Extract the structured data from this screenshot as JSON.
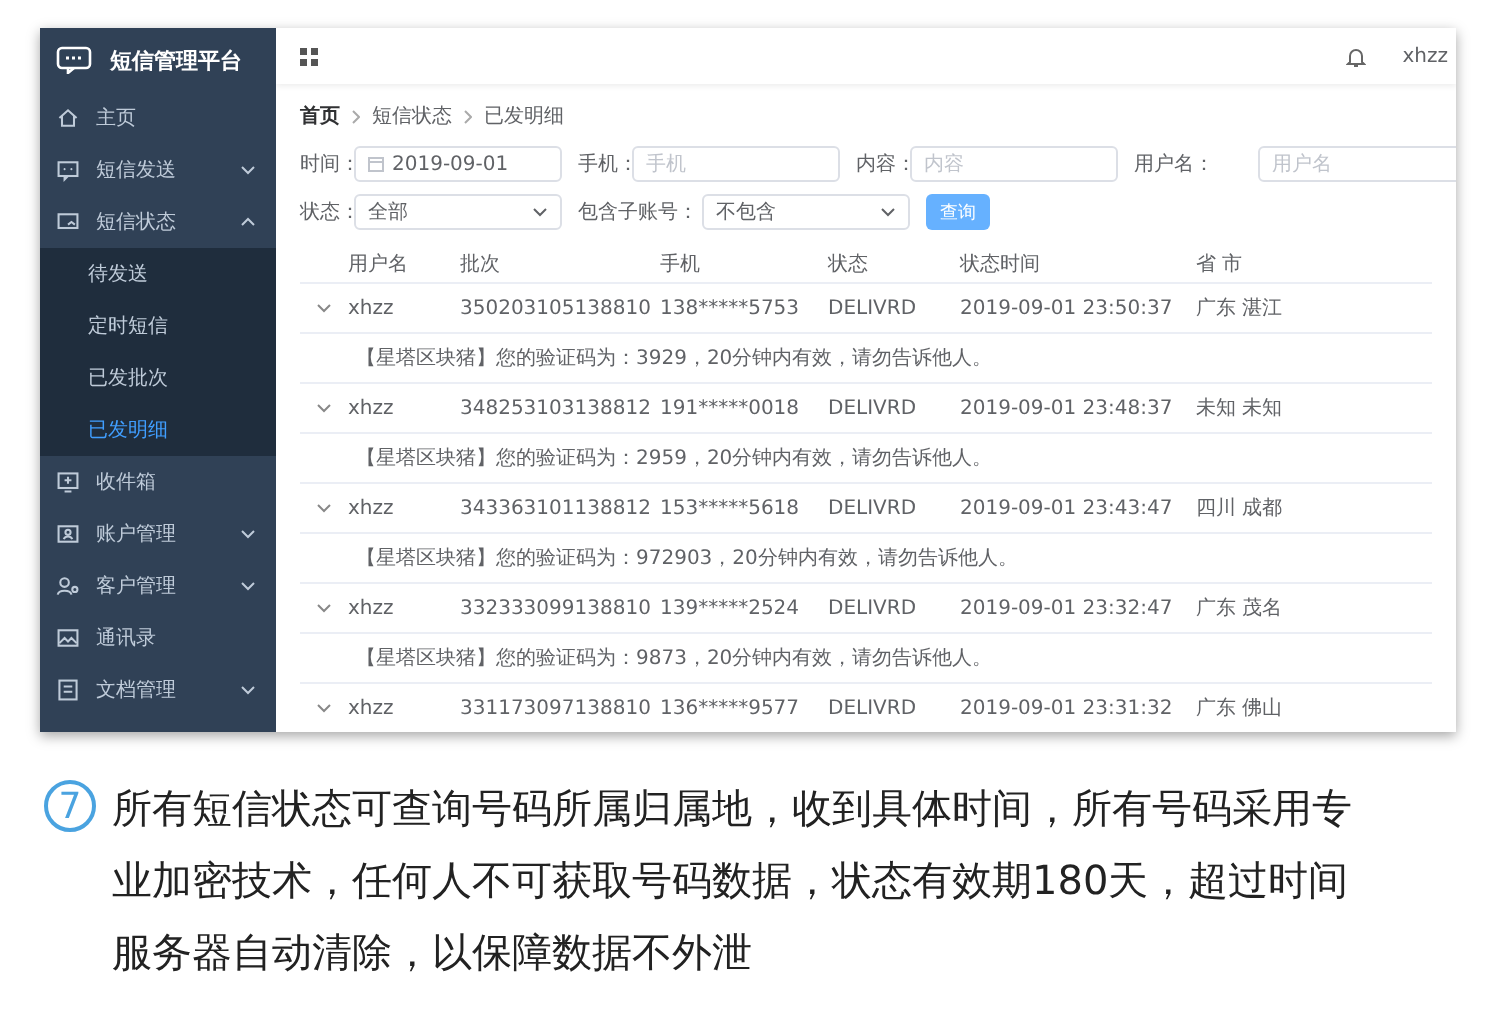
{
  "sidebar": {
    "title": "短信管理平台",
    "items": [
      {
        "label": "主页",
        "kind": "link",
        "selected": false
      },
      {
        "label": "短信发送",
        "kind": "group",
        "expanded": false
      },
      {
        "label": "短信状态",
        "kind": "group",
        "expanded": true,
        "children": [
          {
            "label": "待发送",
            "selected": false
          },
          {
            "label": "定时短信",
            "selected": false
          },
          {
            "label": "已发批次",
            "selected": false
          },
          {
            "label": "已发明细",
            "selected": true
          }
        ]
      },
      {
        "label": "收件箱",
        "kind": "link",
        "selected": false
      },
      {
        "label": "账户管理",
        "kind": "group",
        "expanded": false
      },
      {
        "label": "客户管理",
        "kind": "group",
        "expanded": false
      },
      {
        "label": "通讯录",
        "kind": "link",
        "selected": false
      },
      {
        "label": "文档管理",
        "kind": "group",
        "expanded": false
      }
    ]
  },
  "header": {
    "user": "xhzz"
  },
  "breadcrumb": [
    "首页",
    "短信状态",
    "已发明细"
  ],
  "filters": [
    {
      "kind": "date",
      "label": "时间：",
      "value": "2019-09-01"
    },
    {
      "kind": "input",
      "label": "手机：",
      "placeholder": "手机"
    },
    {
      "kind": "input",
      "label": "内容：",
      "placeholder": "内容"
    },
    {
      "kind": "input",
      "label": "用户名：",
      "placeholder": "用户名"
    },
    {
      "kind": "select",
      "label": "状态：",
      "value": "全部"
    },
    {
      "kind": "select",
      "label": "包含子账号：",
      "value": "不包含"
    },
    {
      "kind": "button",
      "label": "查询"
    }
  ],
  "table": {
    "columns": [
      "用户名",
      "批次",
      "手机",
      "状态",
      "状态时间",
      "省 市"
    ],
    "rows": [
      {
        "cells": [
          "xhzz",
          "350203105138810",
          "138*****5753",
          "DELIVRD",
          "2019-09-01 23:50:37",
          "广东 湛江"
        ],
        "message": "【星塔区块猪】您的验证码为：3929，20分钟内有效，请勿告诉他人。"
      },
      {
        "cells": [
          "xhzz",
          "348253103138812",
          "191*****0018",
          "DELIVRD",
          "2019-09-01 23:48:37",
          "未知 未知"
        ],
        "message": "【星塔区块猪】您的验证码为：2959，20分钟内有效，请勿告诉他人。"
      },
      {
        "cells": [
          "xhzz",
          "343363101138812",
          "153*****5618",
          "DELIVRD",
          "2019-09-01 23:43:47",
          "四川 成都"
        ],
        "message": "【星塔区块猪】您的验证码为：972903，20分钟内有效，请勿告诉他人。"
      },
      {
        "cells": [
          "xhzz",
          "332333099138810",
          "139*****2524",
          "DELIVRD",
          "2019-09-01 23:32:47",
          "广东 茂名"
        ],
        "message": "【星塔区块猪】您的验证码为：9873，20分钟内有效，请勿告诉他人。"
      },
      {
        "cells": [
          "xhzz",
          "331173097138810",
          "136*****9577",
          "DELIVRD",
          "2019-09-01 23:31:32",
          "广东 佛山"
        ]
      }
    ]
  },
  "caption": {
    "number": "7",
    "text": "所有短信状态可查询号码所属归属地，收到具体时间，所有号码采用专业加密技术，任何人不可获取号码数据，状态有效期180天，超过时间服务器自动清除，以保障数据不外泄"
  }
}
